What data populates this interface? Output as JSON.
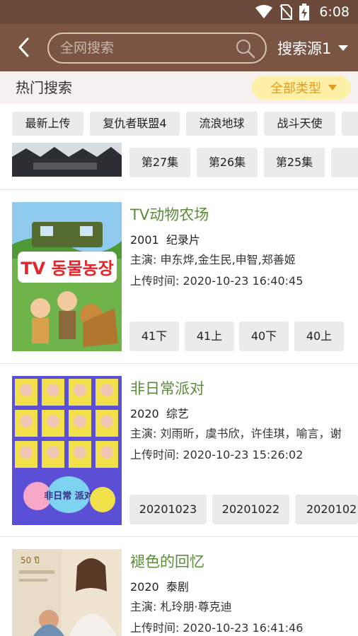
{
  "status_bar": {
    "time": "6:08"
  },
  "header": {
    "search_placeholder": "全网搜索",
    "source_label": "搜索源1"
  },
  "hot_search": {
    "title": "热门搜索",
    "type_filter": "全部类型"
  },
  "tags": [
    "最新上传",
    "复仇者联盟4",
    "流浪地球",
    "战斗天使"
  ],
  "partial_item": {
    "episodes": [
      "第27集",
      "第26集",
      "第25集",
      "第"
    ]
  },
  "items": [
    {
      "title": "TV动物农场",
      "year": "2001",
      "genre": "纪录片",
      "cast": "主演: 申东烨,金生民,申智,郑善姬",
      "uploaded": "上传时间: 2020-10-23 16:40:45",
      "poster_text": "TV 동물농장",
      "episodes": [
        "41下",
        "41上",
        "40下",
        "40上"
      ]
    },
    {
      "title": "非日常派对",
      "year": "2020",
      "genre": "综艺",
      "cast": "主演: 刘雨昕，虞书欣，许佳琪，喻言，谢...",
      "uploaded": "上传时间: 2020-10-23 15:26:02",
      "poster_text": "非日常 派对",
      "episodes": [
        "20201023",
        "20201022",
        "2020102"
      ]
    },
    {
      "title": "褪色的回忆",
      "year": "2020",
      "genre": "泰剧",
      "cast": "主演: 札玲朋·尊克迪",
      "uploaded": "上传时间: 2020-10-23 16:41:46",
      "poster_text": "50 ปี",
      "episodes": []
    }
  ],
  "colors": {
    "status_bar": "#6b4938",
    "header": "#7a5544",
    "title_green": "#5b8b3a",
    "filter_bg": "#fff0a8",
    "filter_text": "#e59a1a"
  }
}
